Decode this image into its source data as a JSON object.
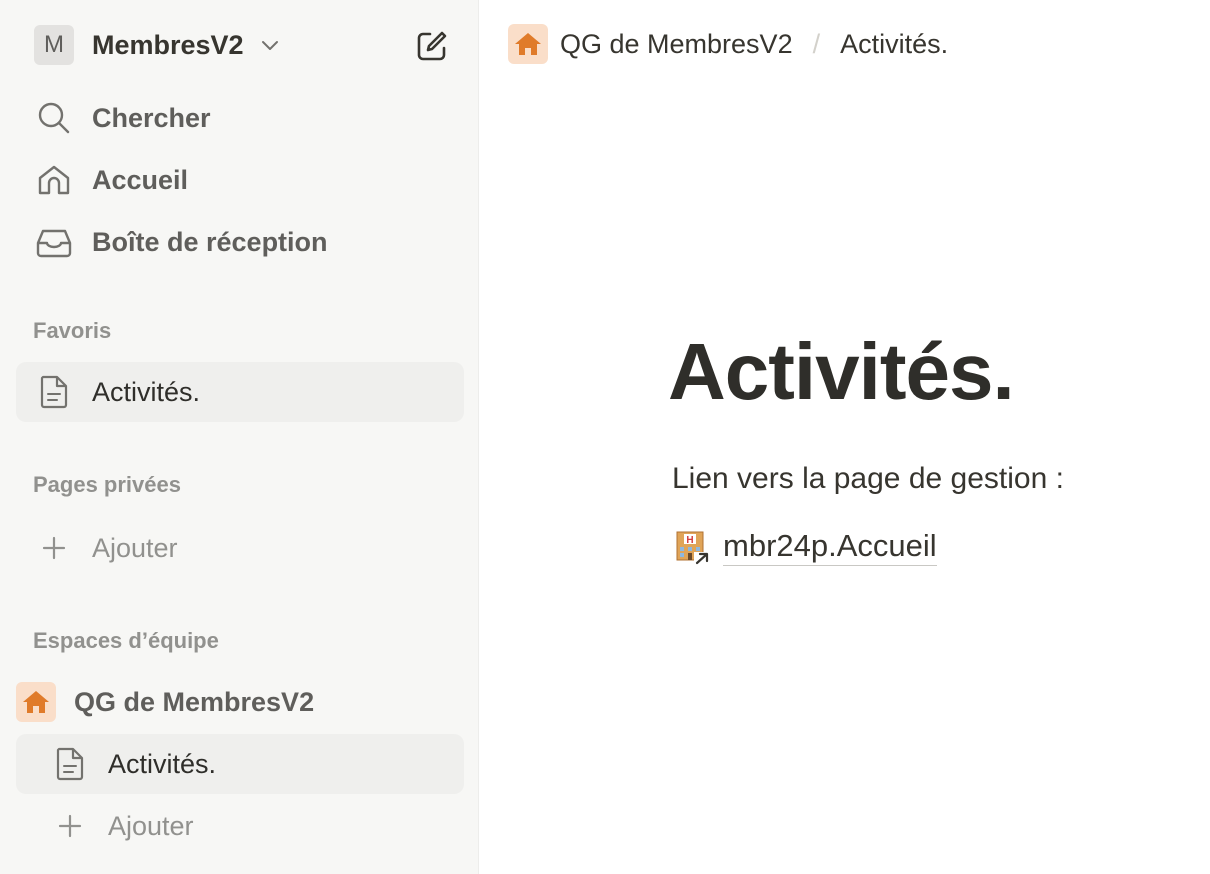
{
  "sidebar": {
    "workspace": {
      "avatar_letter": "M",
      "name": "MembresV2"
    },
    "nav": [
      {
        "label": "Chercher",
        "icon": "search-icon"
      },
      {
        "label": "Accueil",
        "icon": "home-icon"
      },
      {
        "label": "Boîte de réception",
        "icon": "inbox-icon"
      }
    ],
    "favorites": {
      "label": "Favoris",
      "items": [
        {
          "label": "Activités.",
          "icon": "page-icon"
        }
      ]
    },
    "private": {
      "label": "Pages privées",
      "add_label": "Ajouter"
    },
    "teamspaces": {
      "label": "Espaces d’équipe",
      "team_name": "QG de MembresV2",
      "items": [
        {
          "label": "Activités.",
          "icon": "page-icon"
        }
      ],
      "add_label": "Ajouter"
    }
  },
  "breadcrumb": {
    "items": [
      "QG de MembresV2",
      "Activités."
    ],
    "separator": "/"
  },
  "page": {
    "title": "Activités.",
    "text": "Lien vers la page de gestion :",
    "link_label": "mbr24p.Accueil"
  },
  "colors": {
    "sidebar_bg": "#f7f7f5",
    "active_item_bg": "#efefed",
    "team_icon_bg": "#fadec9",
    "team_icon_fg": "#e07b2a"
  }
}
